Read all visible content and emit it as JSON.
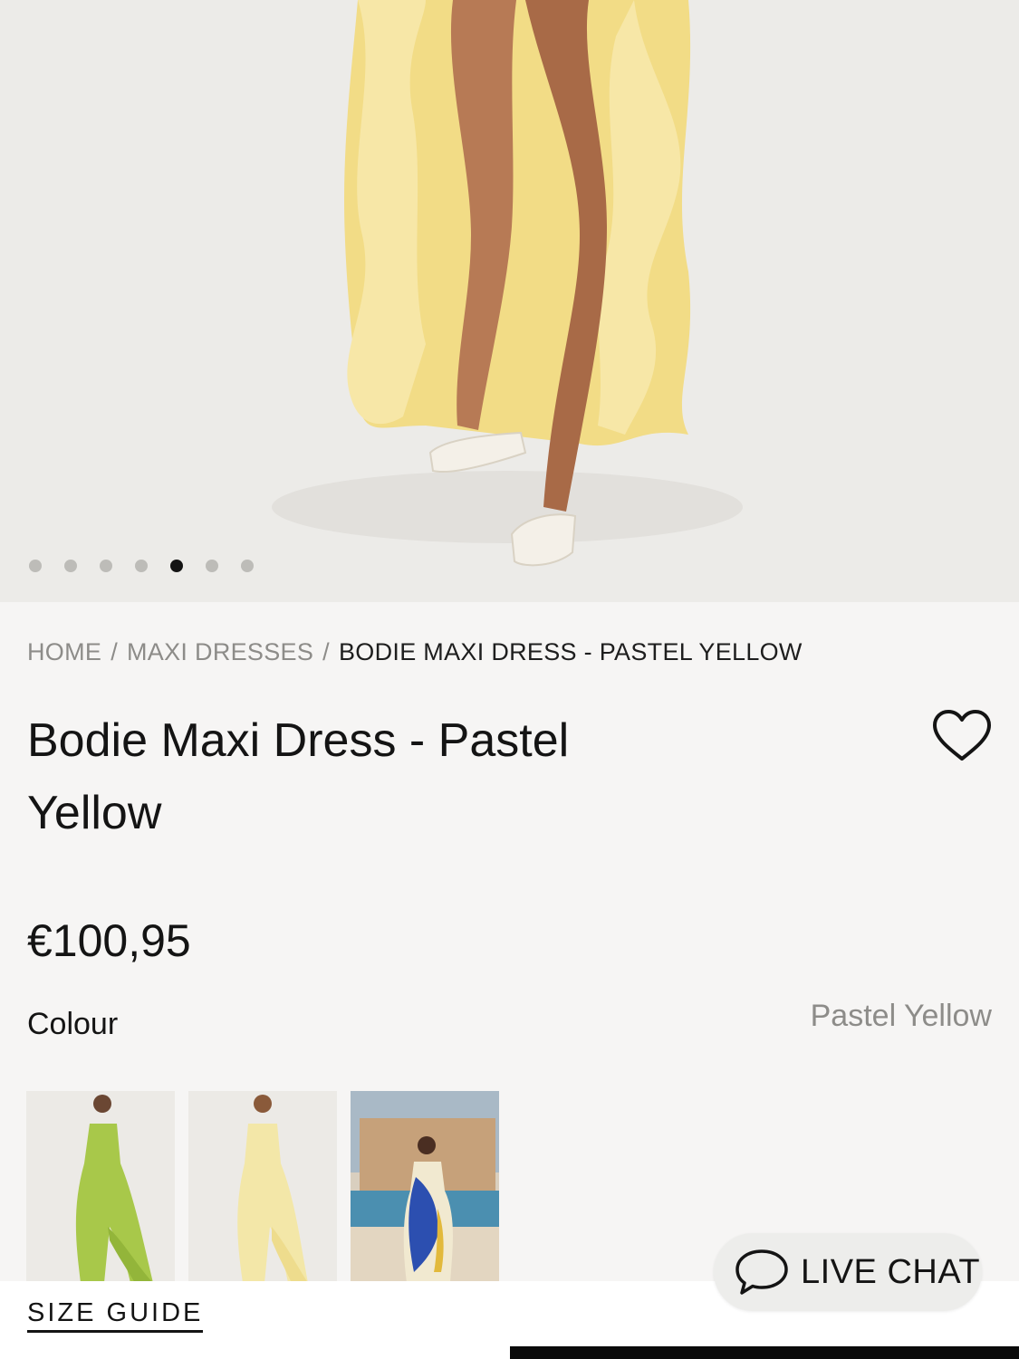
{
  "gallery": {
    "image_count": 7,
    "active_index": 4
  },
  "breadcrumb": {
    "items": [
      "HOME",
      "MAXI DRESSES"
    ],
    "current": "BODIE MAXI DRESS - PASTEL YELLOW",
    "separator": "/"
  },
  "product": {
    "title": "Bodie Maxi Dress - Pastel Yellow",
    "price": "€100,95",
    "colour_label": "Colour",
    "colour_value": "Pastel Yellow",
    "swatches": [
      {
        "color_name": "lime green",
        "hex": "#a8c84a"
      },
      {
        "color_name": "pastel yellow",
        "hex": "#f3e7a8"
      },
      {
        "color_name": "blue print",
        "hex": "#2c4fb0"
      }
    ]
  },
  "footer": {
    "size_guide": "SIZE GUIDE",
    "live_chat": "LIVE CHAT"
  },
  "icons": {
    "heart": "heart-icon",
    "chat": "chat-bubble-icon"
  }
}
